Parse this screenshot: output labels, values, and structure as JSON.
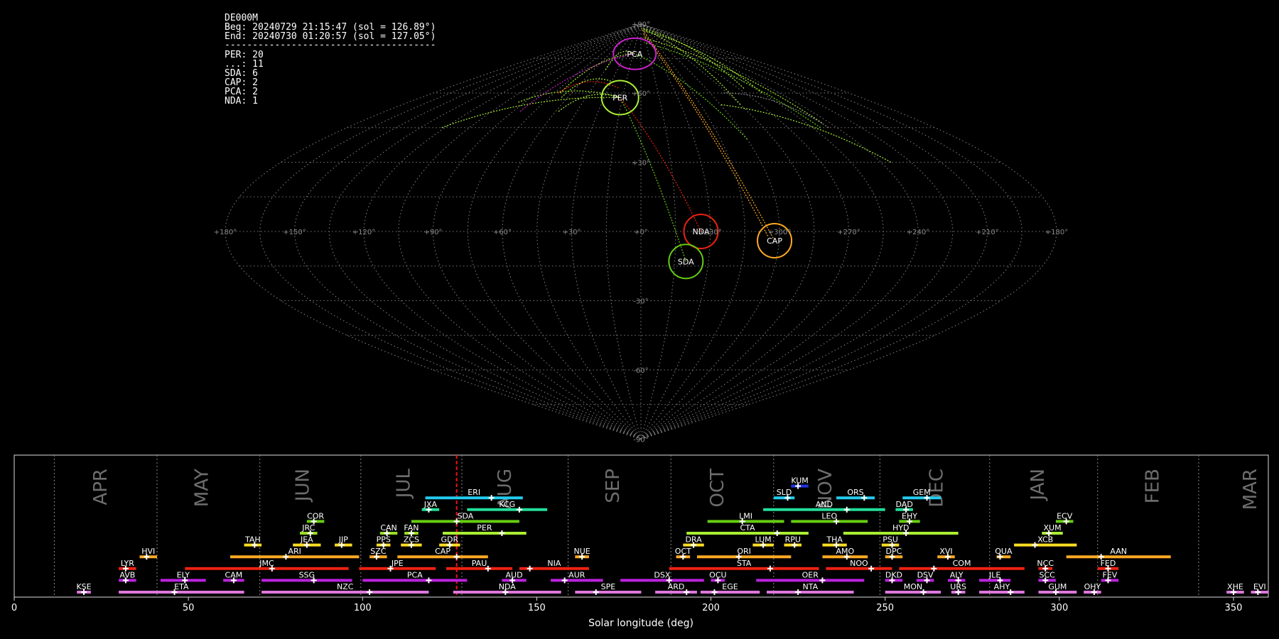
{
  "header": {
    "camera": "DE000M",
    "begin": "Beg: 20240729 21:15:47 (sol = 126.89°)",
    "end": "End: 20240730 01:20:57 (sol = 127.05°)",
    "separator": "--------------------------------------",
    "counts": [
      "PER: 20",
      "...: 11",
      "SDA: 6",
      "CAP: 2",
      "PCA: 2",
      "NDA: 1"
    ]
  },
  "sky_map": {
    "projection": "sinusoidal",
    "lon_labels": [
      {
        "lon": -180,
        "text": "+180°"
      },
      {
        "lon": -150,
        "text": "+150°"
      },
      {
        "lon": -120,
        "text": "+120°"
      },
      {
        "lon": -90,
        "text": "+90°"
      },
      {
        "lon": -60,
        "text": "+60°"
      },
      {
        "lon": -30,
        "text": "+30°"
      },
      {
        "lon": 0,
        "text": "+0°"
      },
      {
        "lon": 30,
        "text": "+330°"
      },
      {
        "lon": 60,
        "text": "+300°"
      },
      {
        "lon": 90,
        "text": "+270°"
      },
      {
        "lon": 120,
        "text": "+240°"
      },
      {
        "lon": 150,
        "text": "+210°"
      },
      {
        "lon": 180,
        "text": "+180°"
      }
    ],
    "lat_labels": [
      {
        "lat": 90,
        "text": "+90°"
      },
      {
        "lat": 60,
        "text": "+60°"
      },
      {
        "lat": 30,
        "text": "+30°"
      },
      {
        "lat": -30,
        "text": "-30°"
      },
      {
        "lat": -60,
        "text": "-60°"
      },
      {
        "lat": -90,
        "text": "-90°"
      }
    ],
    "radiants": [
      {
        "code": "PCA",
        "lon": -12,
        "lat": 77,
        "color": "#cc22cc",
        "rx": 30,
        "ry": 22
      },
      {
        "code": "PER",
        "lon": -17,
        "lat": 58,
        "color": "#aaee33",
        "rx": 26,
        "ry": 24
      },
      {
        "code": "NDA",
        "lon": 26,
        "lat": 0,
        "color": "#ee2211",
        "rx": 24,
        "ry": 24
      },
      {
        "code": "CAP",
        "lon": 58,
        "lat": -4,
        "color": "#ffaa22",
        "rx": 24,
        "ry": 24
      },
      {
        "code": "SDA",
        "lon": 20,
        "lat": -13,
        "color": "#66cc11",
        "rx": 24,
        "ry": 24
      }
    ],
    "tracks": [
      {
        "c": "#aaee33",
        "from": [
          -122,
          45
        ],
        "to": [
          -17,
          58
        ]
      },
      {
        "c": "#aaee33",
        "from": [
          -95,
          56
        ],
        "to": [
          -17,
          58
        ]
      },
      {
        "c": "#aaee33",
        "from": [
          -70,
          60
        ],
        "to": [
          -12,
          77
        ]
      },
      {
        "c": "#aaee33",
        "from": [
          -58,
          52
        ],
        "to": [
          -17,
          58
        ]
      },
      {
        "c": "#aaee33",
        "from": [
          -45,
          70
        ],
        "to": [
          -12,
          77
        ]
      },
      {
        "c": "#aaee33",
        "from": [
          105,
          60
        ],
        "to": [
          10,
          87
        ]
      },
      {
        "c": "#aaee33",
        "from": [
          115,
          47
        ],
        "to": [
          8,
          84
        ]
      },
      {
        "c": "#aaee33",
        "from": [
          95,
          62
        ],
        "to": [
          15,
          88
        ]
      },
      {
        "c": "#66cc11",
        "from": [
          20,
          -13
        ],
        "to": [
          -17,
          58
        ]
      },
      {
        "c": "#66cc11",
        "from": [
          110,
          45
        ],
        "to": [
          10,
          82
        ]
      },
      {
        "c": "#66cc11",
        "from": [
          60,
          40
        ],
        "to": [
          -12,
          77
        ]
      },
      {
        "c": "#cc22cc",
        "from": [
          -85,
          52
        ],
        "to": [
          -12,
          77
        ]
      },
      {
        "c": "#ee2211",
        "from": [
          26,
          0
        ],
        "to": [
          -17,
          58
        ]
      },
      {
        "c": "#ee2211",
        "from": [
          -72,
          60
        ],
        "to": [
          -20,
          62
        ]
      },
      {
        "c": "#ffaa22",
        "from": [
          58,
          -4
        ],
        "to": [
          5,
          88
        ]
      },
      {
        "c": "#ffaa22",
        "from": [
          55,
          -2
        ],
        "to": [
          12,
          86
        ]
      },
      {
        "c": "#aaee33",
        "from": [
          -65,
          58
        ],
        "to": [
          -30,
          65
        ]
      },
      {
        "c": "#aaee33",
        "from": [
          75,
          55
        ],
        "to": [
          8,
          88
        ]
      },
      {
        "c": "#aaee33",
        "from": [
          125,
          30
        ],
        "to": [
          60,
          55
        ]
      },
      {
        "c": "#888888",
        "from": [
          115,
          45
        ],
        "to": [
          70,
          60
        ]
      }
    ]
  },
  "chart_data": {
    "type": "gantt",
    "xlabel": "Solar longitude (deg)",
    "xlim": [
      0,
      360
    ],
    "xticks": [
      0,
      50,
      100,
      150,
      200,
      250,
      300,
      350
    ],
    "current_sol": 127,
    "month_boundaries": [
      11.5,
      41,
      70.5,
      99.5,
      128.5,
      159,
      188.5,
      218,
      248.5,
      280,
      311,
      340
    ],
    "months": [
      {
        "label": "APR",
        "x": 25
      },
      {
        "label": "MAY",
        "x": 54
      },
      {
        "label": "JUN",
        "x": 83
      },
      {
        "label": "JUL",
        "x": 112
      },
      {
        "label": "AUG",
        "x": 141
      },
      {
        "label": "SEP",
        "x": 172
      },
      {
        "label": "OCT",
        "x": 202
      },
      {
        "label": "NOV",
        "x": 233
      },
      {
        "label": "DEC",
        "x": 265
      },
      {
        "label": "JAN",
        "x": 294
      },
      {
        "label": "FEB",
        "x": 327
      },
      {
        "label": "MAR",
        "x": 355
      }
    ],
    "showers": [
      {
        "code": "KUM",
        "s": 223,
        "e": 228,
        "p": 225,
        "row": 9,
        "c": "#2233dd"
      },
      {
        "code": "ERI",
        "s": 118,
        "e": 146,
        "p": 137,
        "row": 8,
        "c": "#22ccee"
      },
      {
        "code": "SLD",
        "s": 218,
        "e": 224,
        "p": 222,
        "row": 8,
        "c": "#22ccee"
      },
      {
        "code": "ORS",
        "s": 236,
        "e": 247,
        "p": 244,
        "row": 8,
        "c": "#22ccee"
      },
      {
        "code": "GEM",
        "s": 255,
        "e": 266,
        "p": 262,
        "row": 8,
        "c": "#22ccee"
      },
      {
        "code": "JXA",
        "s": 117,
        "e": 122,
        "p": 119,
        "row": 7,
        "c": "#22dd99"
      },
      {
        "code": "KCG",
        "s": 130,
        "e": 153,
        "p": 145,
        "row": 7,
        "c": "#22dd99"
      },
      {
        "code": "AND",
        "s": 215,
        "e": 250,
        "p": 239,
        "row": 7,
        "c": "#22dd99"
      },
      {
        "code": "DAD",
        "s": 253,
        "e": 258,
        "p": 256,
        "row": 7,
        "c": "#22dd99"
      },
      {
        "code": "COR",
        "s": 84,
        "e": 89,
        "p": 86,
        "row": 6,
        "c": "#66cc11"
      },
      {
        "code": "SDA",
        "s": 114,
        "e": 145,
        "p": 127,
        "row": 6,
        "c": "#66cc11"
      },
      {
        "code": "LMI",
        "s": 199,
        "e": 221,
        "p": 209,
        "row": 6,
        "c": "#66cc11"
      },
      {
        "code": "LEO",
        "s": 223,
        "e": 245,
        "p": 236,
        "row": 6,
        "c": "#66cc11"
      },
      {
        "code": "EHY",
        "s": 254,
        "e": 260,
        "p": 257,
        "row": 6,
        "c": "#66cc11"
      },
      {
        "code": "ECV",
        "s": 299,
        "e": 304,
        "p": 302,
        "row": 6,
        "c": "#66cc11"
      },
      {
        "code": "JRC",
        "s": 82,
        "e": 87,
        "p": 85,
        "row": 5,
        "c": "#99dd22"
      },
      {
        "code": "CAN",
        "s": 105,
        "e": 110,
        "p": 107,
        "row": 5,
        "c": "#99dd22"
      },
      {
        "code": "FAN",
        "s": 112,
        "e": 116,
        "p": 114,
        "row": 5,
        "c": "#99dd22"
      },
      {
        "code": "PER",
        "s": 123,
        "e": 147,
        "p": 140,
        "row": 5,
        "c": "#aaee33"
      },
      {
        "code": "CTA",
        "s": 193,
        "e": 228,
        "p": 219,
        "row": 5,
        "c": "#aaee33"
      },
      {
        "code": "HYD",
        "s": 238,
        "e": 271,
        "p": 256,
        "row": 5,
        "c": "#aaee33"
      },
      {
        "code": "XUM",
        "s": 295,
        "e": 301,
        "p": 297,
        "row": 5,
        "c": "#aaee33"
      },
      {
        "code": "TAH",
        "s": 66,
        "e": 71,
        "p": 69,
        "row": 4,
        "c": "#ffdd22"
      },
      {
        "code": "JEA",
        "s": 80,
        "e": 88,
        "p": 84,
        "row": 4,
        "c": "#ffdd22"
      },
      {
        "code": "JIP",
        "s": 92,
        "e": 97,
        "p": 94,
        "row": 4,
        "c": "#ffdd22"
      },
      {
        "code": "PPS",
        "s": 104,
        "e": 108,
        "p": 106,
        "row": 4,
        "c": "#ffdd22"
      },
      {
        "code": "ZCS",
        "s": 111,
        "e": 117,
        "p": 114,
        "row": 4,
        "c": "#ffdd22"
      },
      {
        "code": "GDR",
        "s": 122,
        "e": 128,
        "p": 125,
        "row": 4,
        "c": "#ffdd22"
      },
      {
        "code": "DRA",
        "s": 192,
        "e": 198,
        "p": 195,
        "row": 4,
        "c": "#ffdd22"
      },
      {
        "code": "LUM",
        "s": 212,
        "e": 218,
        "p": 215,
        "row": 4,
        "c": "#ffdd22"
      },
      {
        "code": "RPU",
        "s": 221,
        "e": 226,
        "p": 224,
        "row": 4,
        "c": "#ffdd22"
      },
      {
        "code": "THA",
        "s": 232,
        "e": 239,
        "p": 236,
        "row": 4,
        "c": "#ffdd22"
      },
      {
        "code": "PSU",
        "s": 249,
        "e": 254,
        "p": 252,
        "row": 4,
        "c": "#ffdd22"
      },
      {
        "code": "XCB",
        "s": 287,
        "e": 305,
        "p": 293,
        "row": 4,
        "c": "#ffdd22"
      },
      {
        "code": "HVI",
        "s": 36,
        "e": 41,
        "p": 38,
        "row": 3,
        "c": "#ffaa22"
      },
      {
        "code": "ARI",
        "s": 62,
        "e": 99,
        "p": 78,
        "row": 3,
        "c": "#ffaa22"
      },
      {
        "code": "SZC",
        "s": 102,
        "e": 107,
        "p": 104,
        "row": 3,
        "c": "#ffaa22"
      },
      {
        "code": "CAP",
        "s": 110,
        "e": 136,
        "p": 127,
        "row": 3,
        "c": "#ffaa22"
      },
      {
        "code": "NUE",
        "s": 161,
        "e": 165,
        "p": 163,
        "row": 3,
        "c": "#ffaa22"
      },
      {
        "code": "OCT",
        "s": 190,
        "e": 194,
        "p": 192,
        "row": 3,
        "c": "#ffaa22"
      },
      {
        "code": "ORI",
        "s": 196,
        "e": 223,
        "p": 208,
        "row": 3,
        "c": "#ffaa22"
      },
      {
        "code": "AMO",
        "s": 232,
        "e": 245,
        "p": 239,
        "row": 3,
        "c": "#ffaa22"
      },
      {
        "code": "DPC",
        "s": 250,
        "e": 255,
        "p": 252,
        "row": 3,
        "c": "#ffaa22"
      },
      {
        "code": "XVI",
        "s": 265,
        "e": 270,
        "p": 268,
        "row": 3,
        "c": "#ffaa22"
      },
      {
        "code": "QUA",
        "s": 282,
        "e": 286,
        "p": 283,
        "row": 3,
        "c": "#ffaa22"
      },
      {
        "code": "AAN",
        "s": 302,
        "e": 332,
        "p": 312,
        "row": 3,
        "c": "#ffaa22"
      },
      {
        "code": "LYR",
        "s": 30,
        "e": 35,
        "p": 32,
        "row": 2,
        "c": "#ee2211"
      },
      {
        "code": "JMC",
        "s": 49,
        "e": 96,
        "p": 74,
        "row": 2,
        "c": "#ee2211"
      },
      {
        "code": "JPE",
        "s": 99,
        "e": 121,
        "p": 108,
        "row": 2,
        "c": "#ee2211"
      },
      {
        "code": "PAU",
        "s": 124,
        "e": 143,
        "p": 136,
        "row": 2,
        "c": "#ee2211"
      },
      {
        "code": "NIA",
        "s": 145,
        "e": 165,
        "p": 148,
        "row": 2,
        "c": "#ee2211"
      },
      {
        "code": "STA",
        "s": 188,
        "e": 231,
        "p": 217,
        "row": 2,
        "c": "#ee2211"
      },
      {
        "code": "NOO",
        "s": 233,
        "e": 252,
        "p": 246,
        "row": 2,
        "c": "#ee2211"
      },
      {
        "code": "COM",
        "s": 254,
        "e": 290,
        "p": 264,
        "row": 2,
        "c": "#ee2211"
      },
      {
        "code": "NCC",
        "s": 294,
        "e": 298,
        "p": 296,
        "row": 2,
        "c": "#ee2211"
      },
      {
        "code": "FED",
        "s": 311,
        "e": 317,
        "p": 314,
        "row": 2,
        "c": "#ee2211"
      },
      {
        "code": "AVB",
        "s": 30,
        "e": 35,
        "p": 32,
        "row": 1,
        "c": "#bb22dd"
      },
      {
        "code": "ELY",
        "s": 42,
        "e": 55,
        "p": 49,
        "row": 1,
        "c": "#bb22dd"
      },
      {
        "code": "CAM",
        "s": 60,
        "e": 66,
        "p": 63,
        "row": 1,
        "c": "#bb22dd"
      },
      {
        "code": "SSG",
        "s": 71,
        "e": 97,
        "p": 86,
        "row": 1,
        "c": "#bb22dd"
      },
      {
        "code": "PCA",
        "s": 100,
        "e": 130,
        "p": 119,
        "row": 1,
        "c": "#bb22dd"
      },
      {
        "code": "AUD",
        "s": 140,
        "e": 147,
        "p": 143,
        "row": 1,
        "c": "#bb22dd"
      },
      {
        "code": "AUR",
        "s": 154,
        "e": 169,
        "p": 158,
        "row": 1,
        "c": "#bb22dd"
      },
      {
        "code": "DSX",
        "s": 174,
        "e": 198,
        "p": 188,
        "row": 1,
        "c": "#bb22dd"
      },
      {
        "code": "OCU",
        "s": 200,
        "e": 204,
        "p": 202,
        "row": 1,
        "c": "#bb22dd"
      },
      {
        "code": "OER",
        "s": 213,
        "e": 244,
        "p": 232,
        "row": 1,
        "c": "#bb22dd"
      },
      {
        "code": "DKD",
        "s": 250,
        "e": 255,
        "p": 252,
        "row": 1,
        "c": "#bb22dd"
      },
      {
        "code": "DSV",
        "s": 259,
        "e": 264,
        "p": 262,
        "row": 1,
        "c": "#bb22dd"
      },
      {
        "code": "ALY",
        "s": 268,
        "e": 273,
        "p": 271,
        "row": 1,
        "c": "#bb22dd"
      },
      {
        "code": "JLE",
        "s": 277,
        "e": 286,
        "p": 283,
        "row": 1,
        "c": "#bb22dd"
      },
      {
        "code": "SCC",
        "s": 294,
        "e": 299,
        "p": 296,
        "row": 1,
        "c": "#bb22dd"
      },
      {
        "code": "FEV",
        "s": 312,
        "e": 317,
        "p": 314,
        "row": 1,
        "c": "#bb22dd"
      },
      {
        "code": "KSE",
        "s": 18,
        "e": 22,
        "p": 20,
        "row": 0,
        "c": "#dd77dd"
      },
      {
        "code": "ETA",
        "s": 30,
        "e": 66,
        "p": 46,
        "row": 0,
        "c": "#dd77dd"
      },
      {
        "code": "NZC",
        "s": 71,
        "e": 119,
        "p": 102,
        "row": 0,
        "c": "#dd77dd"
      },
      {
        "code": "NDA",
        "s": 126,
        "e": 157,
        "p": 141,
        "row": 0,
        "c": "#dd77dd"
      },
      {
        "code": "SPE",
        "s": 161,
        "e": 180,
        "p": 167,
        "row": 0,
        "c": "#dd77dd"
      },
      {
        "code": "ARD",
        "s": 184,
        "e": 196,
        "p": 193,
        "row": 0,
        "c": "#dd77dd"
      },
      {
        "code": "EGE",
        "s": 197,
        "e": 214,
        "p": 201,
        "row": 0,
        "c": "#dd77dd"
      },
      {
        "code": "NTA",
        "s": 216,
        "e": 241,
        "p": 225,
        "row": 0,
        "c": "#dd77dd"
      },
      {
        "code": "MON",
        "s": 250,
        "e": 266,
        "p": 261,
        "row": 0,
        "c": "#dd77dd"
      },
      {
        "code": "URS",
        "s": 269,
        "e": 273,
        "p": 271,
        "row": 0,
        "c": "#dd77dd"
      },
      {
        "code": "AHY",
        "s": 277,
        "e": 290,
        "p": 286,
        "row": 0,
        "c": "#dd77dd"
      },
      {
        "code": "GUM",
        "s": 294,
        "e": 305,
        "p": 299,
        "row": 0,
        "c": "#dd77dd"
      },
      {
        "code": "OHY",
        "s": 307,
        "e": 312,
        "p": 310,
        "row": 0,
        "c": "#dd77dd"
      },
      {
        "code": "XHE",
        "s": 348,
        "e": 353,
        "p": 350,
        "row": 0,
        "c": "#dd77dd"
      },
      {
        "code": "EVI",
        "s": 355,
        "e": 360,
        "p": 357,
        "row": 0,
        "c": "#dd77dd"
      }
    ]
  }
}
